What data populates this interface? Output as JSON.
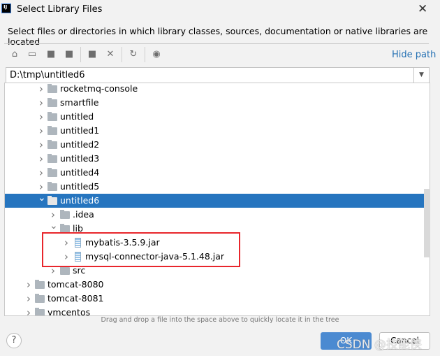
{
  "window": {
    "title": "Select Library Files",
    "logo": "IJ"
  },
  "description": "Select files or directories in which library classes, sources, documentation or native libraries are located",
  "toolbar": {
    "icons": [
      "home-icon",
      "desktop-icon",
      "project-folder-icon",
      "module-folder-icon",
      "new-folder-icon",
      "delete-icon",
      "refresh-icon",
      "show-hidden-icon"
    ],
    "hide_path": "Hide path"
  },
  "path": {
    "value": "D:\\tmp\\untitled6"
  },
  "tree": [
    {
      "label": "rocketmq-console",
      "level": 1,
      "type": "folder",
      "state": "collapsed"
    },
    {
      "label": "smartfile",
      "level": 1,
      "type": "folder",
      "state": "collapsed"
    },
    {
      "label": "untitled",
      "level": 1,
      "type": "folder",
      "state": "collapsed"
    },
    {
      "label": "untitled1",
      "level": 1,
      "type": "folder",
      "state": "collapsed"
    },
    {
      "label": "untitled2",
      "level": 1,
      "type": "folder",
      "state": "collapsed"
    },
    {
      "label": "untitled3",
      "level": 1,
      "type": "folder",
      "state": "collapsed"
    },
    {
      "label": "untitled4",
      "level": 1,
      "type": "folder",
      "state": "collapsed"
    },
    {
      "label": "untitled5",
      "level": 1,
      "type": "folder",
      "state": "collapsed"
    },
    {
      "label": "untitled6",
      "level": 1,
      "type": "folder",
      "state": "expanded",
      "selected": true
    },
    {
      "label": ".idea",
      "level": 2,
      "type": "folder",
      "state": "collapsed"
    },
    {
      "label": "lib",
      "level": 2,
      "type": "folder",
      "state": "expanded"
    },
    {
      "label": "mybatis-3.5.9.jar",
      "level": 3,
      "type": "jar",
      "state": "collapsed"
    },
    {
      "label": "mysql-connector-java-5.1.48.jar",
      "level": 3,
      "type": "jar",
      "state": "collapsed"
    },
    {
      "label": "src",
      "level": 2,
      "type": "folder",
      "state": "collapsed"
    },
    {
      "label": "tomcat-8080",
      "level": 0,
      "type": "folder",
      "state": "collapsed"
    },
    {
      "label": "tomcat-8081",
      "level": 0,
      "type": "folder",
      "state": "collapsed"
    },
    {
      "label": "vmcentos",
      "level": 0,
      "type": "folder",
      "state": "collapsed"
    }
  ],
  "hint": "Drag and drop a file into the space above to quickly locate it in the tree",
  "buttons": {
    "help": "?",
    "ok": "OK",
    "cancel": "Cancel"
  },
  "watermark": "CSDN @技能侠",
  "colors": {
    "selection": "#2675bf",
    "accent": "#4b8ad1",
    "link": "#2470b3",
    "highlight_box": "#e8262c"
  }
}
